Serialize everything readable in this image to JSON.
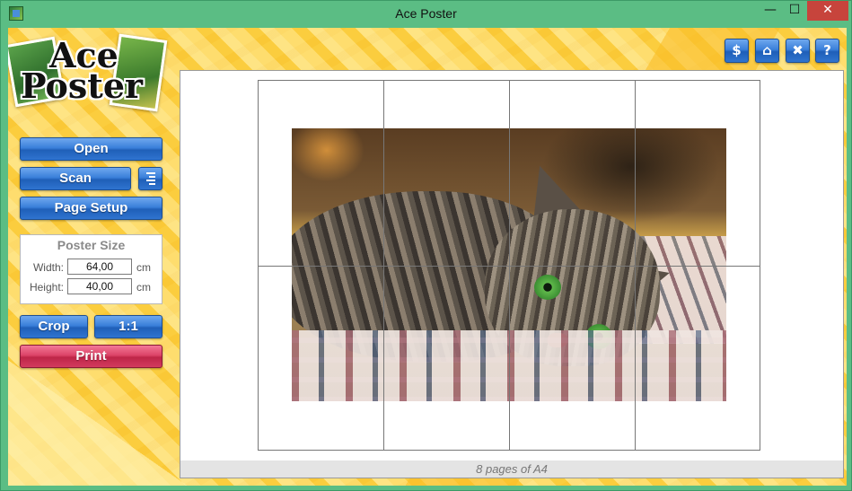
{
  "window": {
    "title": "Ace Poster",
    "minimize_glyph": "—",
    "maximize_glyph": "☐",
    "close_glyph": "✕"
  },
  "logo": {
    "line1": "Ace",
    "line2": "Poster"
  },
  "sidebar": {
    "open_label": "Open",
    "scan_label": "Scan",
    "page_setup_label": "Page Setup",
    "crop_label": "Crop",
    "one_to_one_label": "1:1",
    "print_label": "Print"
  },
  "poster_size": {
    "title": "Poster Size",
    "width_label": "Width:",
    "width_value": "64,00",
    "height_label": "Height:",
    "height_value": "40,00",
    "unit": "cm"
  },
  "toolbar": {
    "buy_glyph": "$",
    "home_glyph": "⌂",
    "settings_glyph": "✖",
    "help_glyph": "?"
  },
  "preview": {
    "grid_columns": 4,
    "grid_rows": 2,
    "status_text": "8 pages of A4"
  },
  "colors": {
    "button_blue": "#3a7fda",
    "button_red": "#dc4468",
    "background_yellow": "#fcd24a",
    "frame_green": "#5bbd84"
  }
}
